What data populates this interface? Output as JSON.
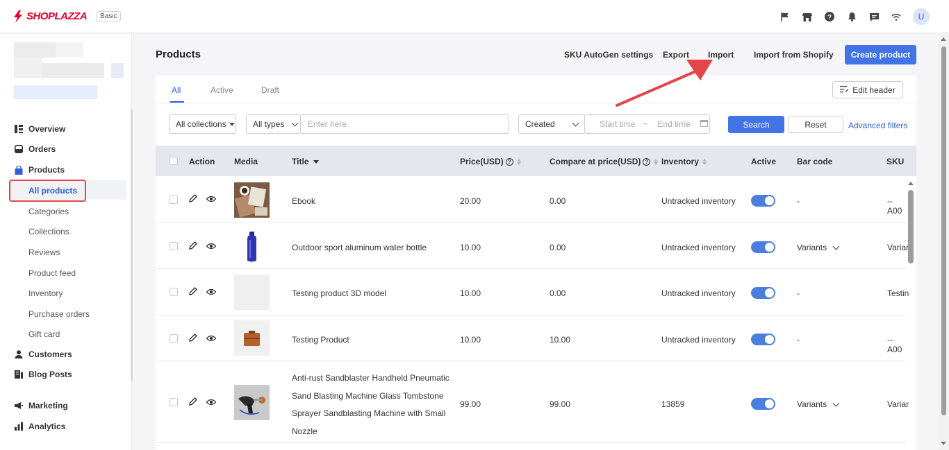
{
  "brand": {
    "name": "SHOPLAZZA",
    "plan": "Basic",
    "accent": "#e4002b"
  },
  "topbar": {
    "icons": [
      "flag-icon",
      "store-icon",
      "help-icon",
      "bell-icon",
      "chat-icon",
      "wifi-icon"
    ],
    "avatar_initial": "U"
  },
  "sidebar": {
    "nav": [
      {
        "label": "Overview",
        "icon": "overview-icon"
      },
      {
        "label": "Orders",
        "icon": "orders-icon"
      },
      {
        "label": "Products",
        "icon": "products-icon"
      }
    ],
    "product_sub": [
      "All products",
      "Categories",
      "Collections",
      "Reviews",
      "Product feed",
      "Inventory",
      "Purchase orders",
      "Gift card"
    ],
    "nav_bottom": [
      {
        "label": "Customers",
        "icon": "customers-icon"
      },
      {
        "label": "Blog Posts",
        "icon": "blog-icon"
      },
      {
        "label": "Marketing",
        "icon": "marketing-icon"
      },
      {
        "label": "Analytics",
        "icon": "analytics-icon"
      }
    ]
  },
  "page": {
    "title": "Products",
    "actions": [
      "SKU AutoGen settings",
      "Export",
      "Import",
      "Import from Shopify"
    ],
    "primary_action": "Create product"
  },
  "tabs": [
    "All",
    "Active",
    "Draft"
  ],
  "edit_header": "Edit header",
  "filters": {
    "collection": "All collections",
    "type": "All types",
    "search_placeholder": "Enter here",
    "date_field": "Created",
    "start_placeholder": "Start time",
    "range_sep": "~",
    "end_placeholder": "End time",
    "search_btn": "Search",
    "reset_btn": "Reset",
    "advanced": "Advanced filters"
  },
  "table": {
    "columns": [
      "Action",
      "Media",
      "Title",
      "Price(USD)",
      "Compare at price(USD)",
      "Inventory",
      "Active",
      "Bar code",
      "SKU"
    ],
    "rows": [
      {
        "title": "Ebook",
        "price": "20.00",
        "compare": "0.00",
        "inventory": "Untracked inventory",
        "active": true,
        "barcode": "-",
        "sku": "--A00"
      },
      {
        "title": "Outdoor sport aluminum water bottle",
        "price": "10.00",
        "compare": "0.00",
        "inventory": "Untracked inventory",
        "active": true,
        "barcode": "Variants",
        "sku": "Variar"
      },
      {
        "title": "Testing product 3D model",
        "price": "10.00",
        "compare": "0.00",
        "inventory": "Untracked inventory",
        "active": true,
        "barcode": "-",
        "sku": "Testin"
      },
      {
        "title": "Testing Product",
        "price": "10.00",
        "compare": "10.00",
        "inventory": "Untracked inventory",
        "active": true,
        "barcode": "-",
        "sku": "--A00"
      },
      {
        "title_lines": [
          "Anti-rust Sandblaster Handheld Pneumatic",
          "Sand Blasting Machine Glass Tombstone",
          "Sprayer Sandblasting Machine with Small",
          "Nozzle"
        ],
        "price": "99.00",
        "compare": "99.00",
        "inventory": "13859",
        "active": true,
        "barcode": "Variants",
        "sku": "Variar"
      }
    ]
  },
  "colors": {
    "primary": "#4374e6",
    "link": "#2d5fdb",
    "highlight": "#e5444a",
    "header_bg": "#e4e7ee"
  }
}
